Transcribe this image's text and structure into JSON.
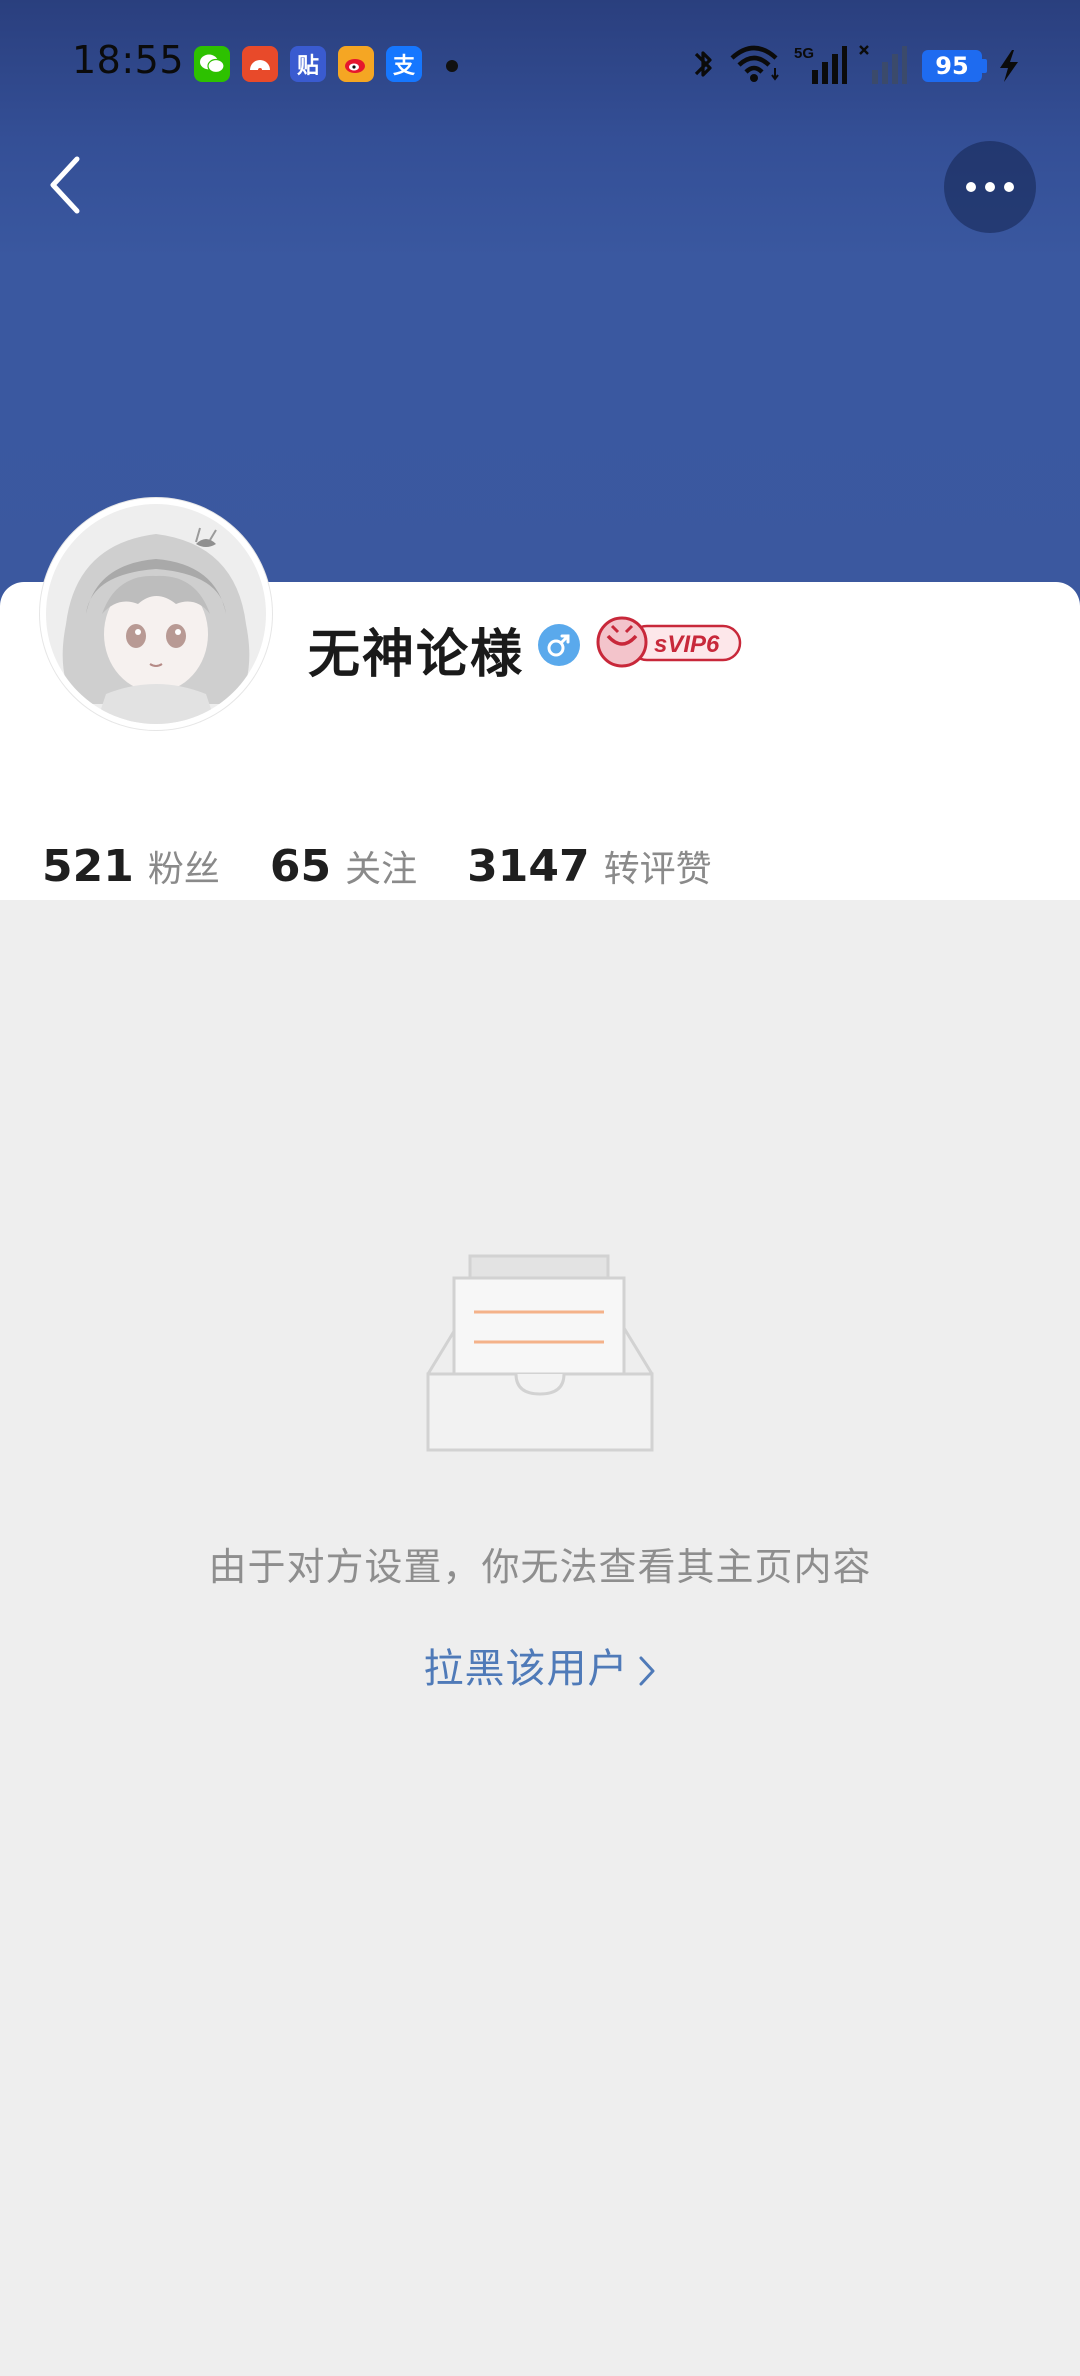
{
  "status_bar": {
    "time": "18:55",
    "apps": [
      {
        "icon": "wechat-icon",
        "glyph": "",
        "color": "#2dc100"
      },
      {
        "icon": "news-app-icon",
        "glyph": "",
        "color": "#e84a2a"
      },
      {
        "icon": "tieba-icon",
        "glyph": "贴",
        "color": "#3a5bd0"
      },
      {
        "icon": "weibo-icon",
        "glyph": "",
        "color": "#f5a623"
      },
      {
        "icon": "alipay-icon",
        "glyph": "支",
        "color": "#1677ff"
      }
    ],
    "network": "5G",
    "battery": "95"
  },
  "header": {
    "banner_color": "#3b589f"
  },
  "profile": {
    "username": "无神论様",
    "gender": "male",
    "gender_color": "#5aa9ec",
    "vip_label": "sVIP6",
    "stats": [
      {
        "value": "521",
        "label": "粉丝"
      },
      {
        "value": "65",
        "label": "关注"
      },
      {
        "value": "3147",
        "label": "转评赞"
      }
    ]
  },
  "empty_state": {
    "message": "由于对方设置，你无法查看其主页内容",
    "action_label": "拉黑该用户"
  },
  "colors": {
    "page_bg": "#eeeeee",
    "link": "#4f7ab8",
    "battery": "#1e6bf0"
  }
}
